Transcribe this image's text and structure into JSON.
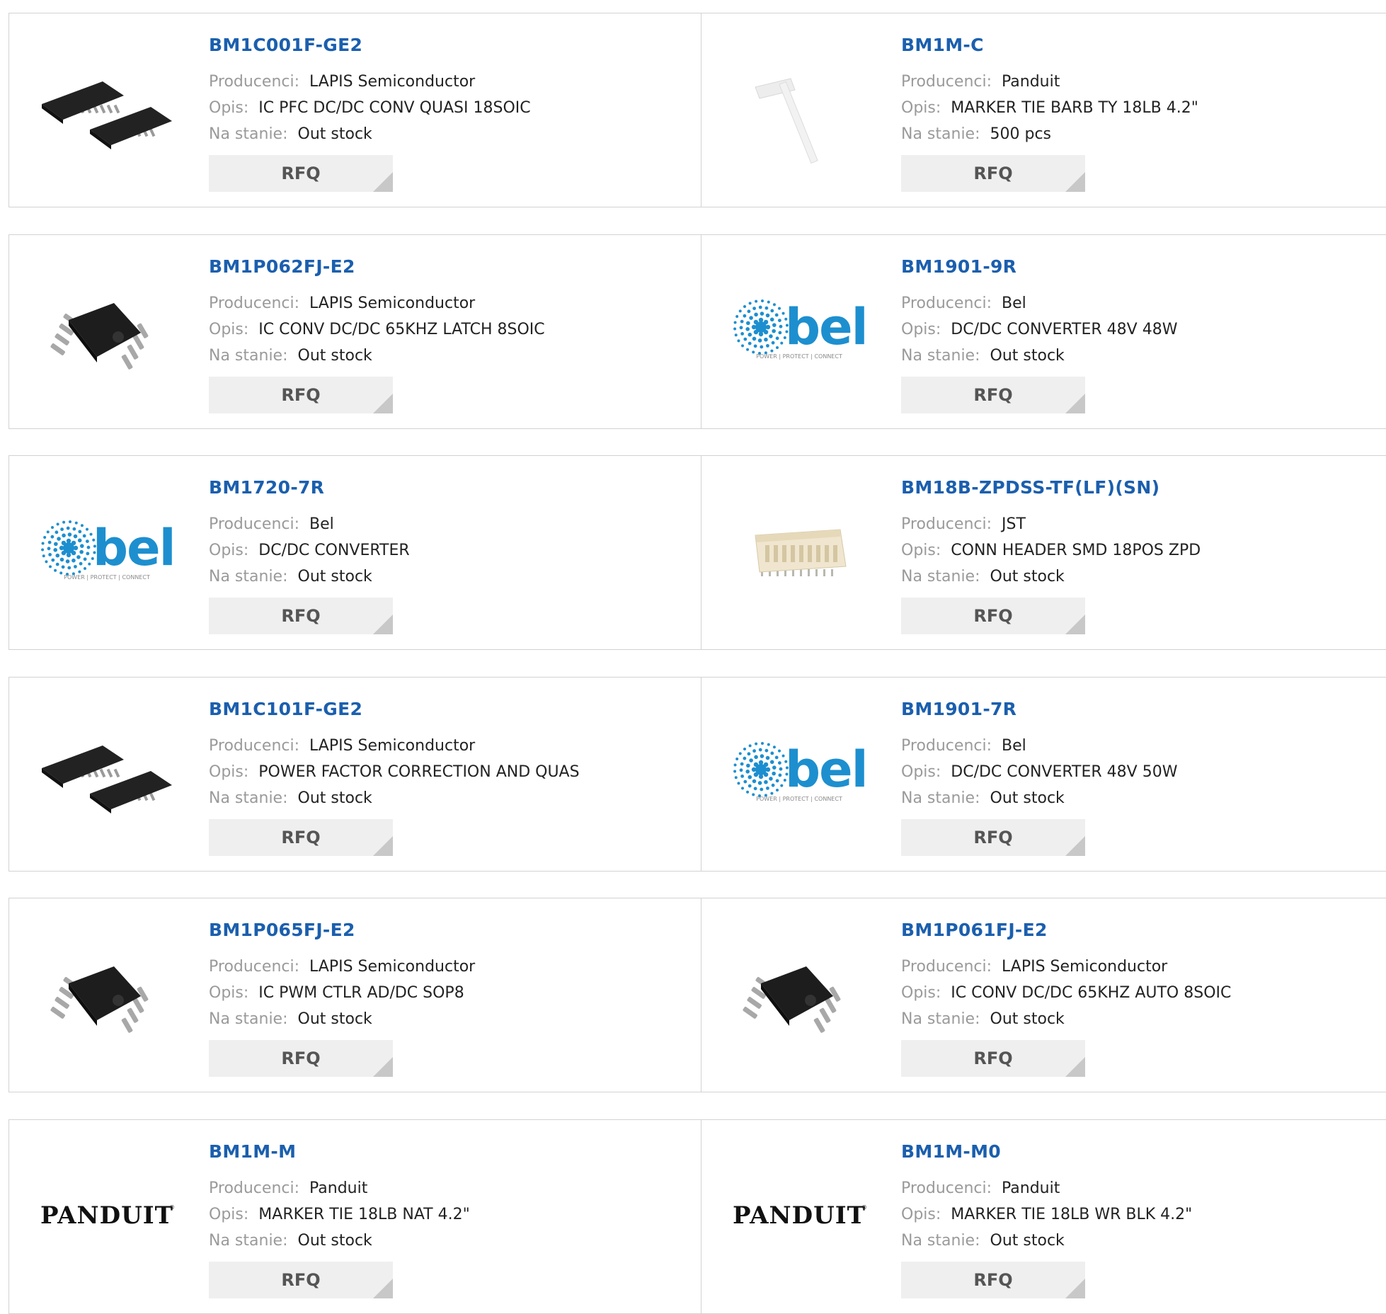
{
  "labels": {
    "manufacturer": "Producenci:",
    "description": "Opis:",
    "stock": "Na stanie:",
    "rfq": "RFQ"
  },
  "colors": {
    "part_link": "#1b5fae",
    "label": "#9a9a9a",
    "button_bg": "#efefef",
    "bel_blue": "#1d8fcf"
  },
  "products": [
    {
      "part": "BM1C001F-GE2",
      "manufacturer": "LAPIS Semiconductor",
      "description": "IC PFC DC/DC CONV QUASI 18SOIC",
      "stock": "Out stock",
      "image": "soic-18-chip-image"
    },
    {
      "part": "BM1M-C",
      "manufacturer": "Panduit",
      "description": "MARKER TIE BARB TY 18LB 4.2\"",
      "stock": "500 pcs",
      "image": "marker-tie-image"
    },
    {
      "part": "BM1P062FJ-E2",
      "manufacturer": "LAPIS Semiconductor",
      "description": "IC CONV DC/DC 65KHZ LATCH 8SOIC",
      "stock": "Out stock",
      "image": "soic-8-chip-image"
    },
    {
      "part": "BM1901-9R",
      "manufacturer": "Bel",
      "description": "DC/DC CONVERTER 48V 48W",
      "stock": "Out stock",
      "image": "bel-logo",
      "logo_text": "bel",
      "logo_tagline": "POWER | PROTECT | CONNECT"
    },
    {
      "part": "BM1720-7R",
      "manufacturer": "Bel",
      "description": "DC/DC CONVERTER",
      "stock": "Out stock",
      "image": "bel-logo",
      "logo_text": "bel",
      "logo_tagline": "POWER | PROTECT | CONNECT"
    },
    {
      "part": "BM18B-ZPDSS-TF(LF)(SN)",
      "manufacturer": "JST",
      "description": "CONN HEADER SMD 18POS ZPD",
      "stock": "Out stock",
      "image": "connector-header-image"
    },
    {
      "part": "BM1C101F-GE2",
      "manufacturer": "LAPIS Semiconductor",
      "description": "POWER FACTOR CORRECTION AND QUAS",
      "stock": "Out stock",
      "image": "soic-18-chip-image"
    },
    {
      "part": "BM1901-7R",
      "manufacturer": "Bel",
      "description": "DC/DC CONVERTER 48V 50W",
      "stock": "Out stock",
      "image": "bel-logo",
      "logo_text": "bel",
      "logo_tagline": "POWER | PROTECT | CONNECT"
    },
    {
      "part": "BM1P065FJ-E2",
      "manufacturer": "LAPIS Semiconductor",
      "description": "IC PWM CTLR AD/DC SOP8",
      "stock": "Out stock",
      "image": "soic-8-chip-image"
    },
    {
      "part": "BM1P061FJ-E2",
      "manufacturer": "LAPIS Semiconductor",
      "description": "IC CONV DC/DC 65KHZ AUTO 8SOIC",
      "stock": "Out stock",
      "image": "soic-8-chip-image"
    },
    {
      "part": "BM1M-M",
      "manufacturer": "Panduit",
      "description": "MARKER TIE 18LB NAT 4.2\"",
      "stock": "Out stock",
      "image": "panduit-logo",
      "logo_text": "PANDUIT"
    },
    {
      "part": "BM1M-M0",
      "manufacturer": "Panduit",
      "description": "MARKER TIE 18LB WR BLK 4.2\"",
      "stock": "Out stock",
      "image": "panduit-logo",
      "logo_text": "PANDUIT"
    }
  ]
}
